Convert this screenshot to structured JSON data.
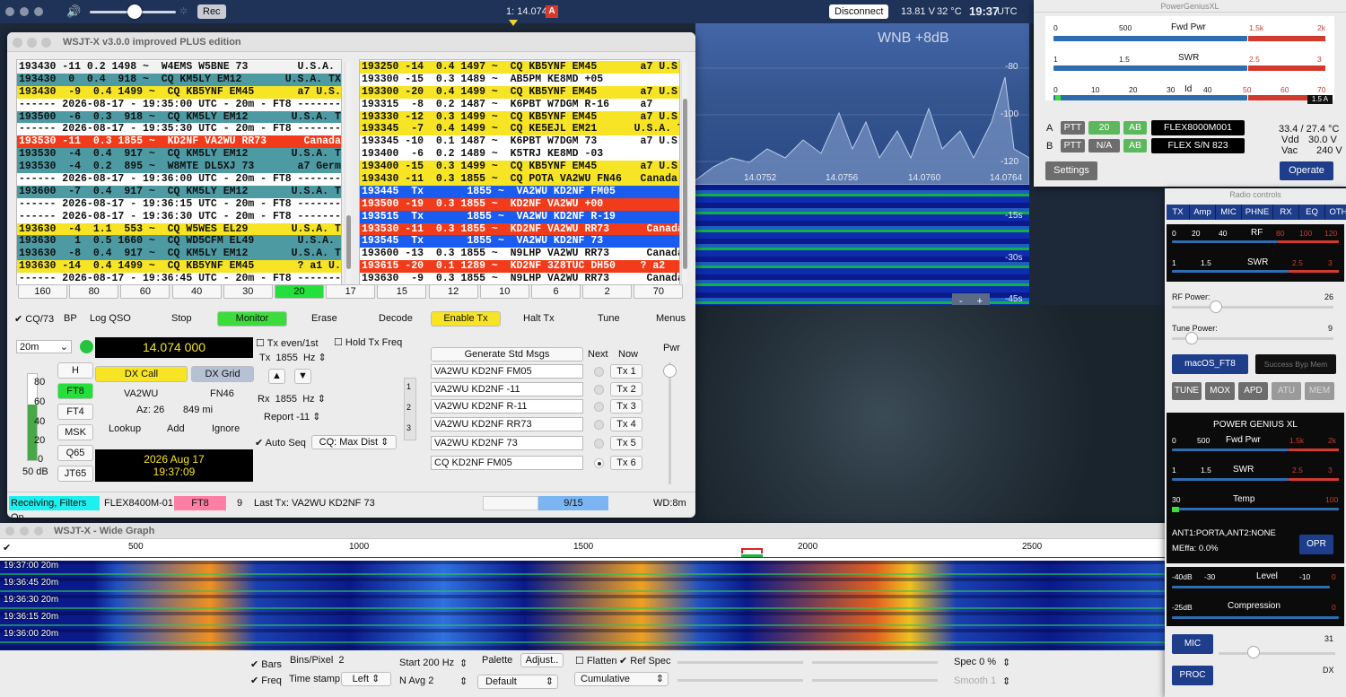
{
  "topbar": {
    "freq": "1: 14.074",
    "freq_flag": "A",
    "disconnect": "Disconnect",
    "volts": "13.81 V",
    "temp": "32 °C",
    "time": "19:37",
    "tz": "UTC",
    "rec": "Rec"
  },
  "pan": {
    "wnb": "WNB +8dB",
    "db": [
      "-80",
      "-100",
      "-120"
    ],
    "freqs": [
      "14.0752",
      "14.0756",
      "14.0760",
      "14.0764"
    ],
    "wf_times": [
      "-15s",
      "-30s",
      "-45s"
    ],
    "zoom_minus": "-",
    "zoom_plus": "+"
  },
  "wsjt": {
    "title": "WSJT-X   v3.0.0  improved PLUS edition",
    "left_rows": [
      {
        "t": "193430 -11 0.2 1498 ~  W4EMS W5BNE 73        U.S.A. TX",
        "c": "#f2f2f2"
      },
      {
        "t": "193430  0  0.4  918 ~  CQ KM5LY EM12       U.S.A. TX",
        "c": "#4d9aa3"
      },
      {
        "t": "193430  -9  0.4 1499 ~  CQ KB5YNF EM45       a7 U.S.A. AR-TN",
        "c": "#f6e425"
      },
      {
        "t": "------ 2026-08-17 - 19:35:00 UTC - 20m - FT8 ---------",
        "c": "#fff"
      },
      {
        "t": "193500  -6  0.3  918 ~  CQ KM5LY EM12       U.S.A. TX",
        "c": "#4d9aa3"
      },
      {
        "t": "------ 2026-08-17 - 19:35:30 UTC - 20m - FT8 ---------",
        "c": "#fff"
      },
      {
        "t": "193530 -11  0.3 1855 ~  KD2NF VA2WU RR73      Canada",
        "c": "#f23b1a"
      },
      {
        "t": "193530  -4  0.4  917 ~  CQ KM5LY EM12       U.S.A. TX",
        "c": "#4d9aa3"
      },
      {
        "t": "193530  -4  0.2  895 ~  W8MTE DL5XJ 73       a7 Germany",
        "c": "#4d9aa3"
      },
      {
        "t": "------ 2026-08-17 - 19:36:00 UTC - 20m - FT8 ---------",
        "c": "#fff"
      },
      {
        "t": "193600  -7  0.4  917 ~  CQ KM5LY EM12       U.S.A. TX",
        "c": "#4d9aa3"
      },
      {
        "t": "------ 2026-08-17 - 19:36:15 UTC - 20m - FT8 ---------",
        "c": "#fff"
      },
      {
        "t": "------ 2026-08-17 - 19:36:30 UTC - 20m - FT8 ---------",
        "c": "#fff"
      },
      {
        "t": "193630  -4  1.1  553 ~  CQ W5WES EL29       U.S.A. TX",
        "c": "#f6e425"
      },
      {
        "t": "193630   1  0.5 1660 ~  CQ WD5CFM EL49       U.S.A. LA",
        "c": "#4d9aa3"
      },
      {
        "t": "193630  -8  0.4  917 ~  CQ KM5LY EM12       U.S.A. TX",
        "c": "#4d9aa3"
      },
      {
        "t": "193630 -14  0.4 1499 ~  CQ KB5YNF EM45       ? a1 U.S.A. AR-TN",
        "c": "#f6e425"
      },
      {
        "t": "------ 2026-08-17 - 19:36:45 UTC - 20m - FT8 ---------",
        "c": "#fff"
      }
    ],
    "right_rows": [
      {
        "t": "193250 -14  0.4 1497 ~  CQ KB5YNF EM45       a7 U.S.A. AR-TN",
        "c": "#f6e425"
      },
      {
        "t": "193300 -15  0.3 1489 ~  AB5PM KE8MD +05",
        "c": "#fff"
      },
      {
        "t": "193300 -20  0.4 1499 ~  CQ KB5YNF EM45       a7 U.S.A. AR-TN",
        "c": "#f6e425"
      },
      {
        "t": "193315  -8  0.2 1487 ~  K6PBT W7DGM R-16     a7",
        "c": "#fff"
      },
      {
        "t": "193330 -12  0.3 1499 ~  CQ KB5YNF EM45       a7 U.S.A. AR-TN",
        "c": "#f6e425"
      },
      {
        "t": "193345  -7  0.4 1499 ~  CQ KE5EJL EM21      U.S.A. TX-LA",
        "c": "#f6e425"
      },
      {
        "t": "193345 -10  0.1 1487 ~  K6PBT W7DGM 73       a7 U.S.A.",
        "c": "#fff"
      },
      {
        "t": "193400  -6  0.2 1489 ~  K5TRJ KE8MD -03",
        "c": "#fff"
      },
      {
        "t": "193400 -15  0.3 1499 ~  CQ KB5YNF EM45       a7 U.S.A. AR-TN",
        "c": "#f6e425"
      },
      {
        "t": "193430 -11  0.3 1855 ~  CQ POTA VA2WU FN46   Canada",
        "c": "#f6e425"
      },
      {
        "t": "193445  Tx       1855 ~  VA2WU KD2NF FM05",
        "c": "#1a5cf0"
      },
      {
        "t": "193500 -19  0.3 1855 ~  KD2NF VA2WU +00",
        "c": "#f23b1a"
      },
      {
        "t": "193515  Tx       1855 ~  VA2WU KD2NF R-19",
        "c": "#1a5cf0"
      },
      {
        "t": "193530 -11  0.3 1855 ~  KD2NF VA2WU RR73      Canada",
        "c": "#f23b1a"
      },
      {
        "t": "193545  Tx       1855 ~  VA2WU KD2NF 73",
        "c": "#1a5cf0"
      },
      {
        "t": "193600 -13  0.3 1855 ~  N9LHP VA2WU RR73      Canada",
        "c": "#fff"
      },
      {
        "t": "193615 -20  0.1 1289 ~  KD2NF 3Z8TUC DH50    ? a2",
        "c": "#f23b1a"
      },
      {
        "t": "193630  -9  0.3 1855 ~  N9LHP VA2WU RR73      Canada",
        "c": "#fff"
      }
    ],
    "bands": [
      "160",
      "80",
      "60",
      "40",
      "30",
      "20",
      "17",
      "15",
      "12",
      "10",
      "6",
      "2",
      "70"
    ],
    "controls": {
      "cq73": "CQ/73",
      "bp": "BP",
      "logqso": "Log QSO",
      "stop": "Stop",
      "monitor": "Monitor",
      "erase": "Erase",
      "decode": "Decode",
      "enabletx": "Enable Tx",
      "halttx": "Halt Tx",
      "tune": "Tune",
      "menus": "Menus"
    },
    "band": "20m",
    "dialfreq": "14.074 000",
    "modes": [
      "H",
      "FT8",
      "FT4",
      "MSK",
      "Q65",
      "JT65"
    ],
    "meter": {
      "scale": [
        "80",
        "60",
        "40",
        "20",
        "0"
      ],
      "db": "50 dB"
    },
    "dxcall_btn": "DX Call",
    "dxgrid_btn": "DX Grid",
    "dxcall": "VA2WU",
    "dxgrid": "FN46",
    "az": "Az: 26",
    "dist": "849 mi",
    "lookup": "Lookup",
    "add": "Add",
    "ignore": "Ignore",
    "date": "2026 Aug 17",
    "utc": "19:37:09",
    "txeven": "Tx even/1st",
    "holdtx": "Hold Tx Freq",
    "tx_lbl": "Tx",
    "tx_hz": "1855",
    "hz": "Hz",
    "rx_lbl": "Rx",
    "rx_hz": "1855",
    "report": "Report -11",
    "autoseq": "Auto Seq",
    "cqmax": "CQ: Max Dist",
    "gen": "Generate Std Msgs",
    "next": "Next",
    "now": "Now",
    "msgs": [
      "VA2WU KD2NF FM05",
      "VA2WU KD2NF -11",
      "VA2WU KD2NF R-11",
      "VA2WU KD2NF RR73",
      "VA2WU KD2NF 73",
      "CQ KD2NF FM05"
    ],
    "txbtns": [
      "Tx 1",
      "Tx 2",
      "Tx 3",
      "Tx 4",
      "Tx 5",
      "Tx 6"
    ],
    "tabs": [
      "1",
      "2",
      "3"
    ],
    "pwr": "Pwr",
    "status": {
      "recv": "Receiving, Filters On",
      "rig": "FLEX8400M-01",
      "mode": "FT8",
      "num": "9",
      "lasttx": "Last Tx: VA2WU KD2NF 73",
      "prog": "9/15",
      "wd": "WD:8m"
    }
  },
  "wide": {
    "title": "WSJT-X - Wide Graph",
    "scale": [
      "500",
      "1000",
      "1500",
      "2000",
      "2500"
    ],
    "times": [
      "19:37:00   20m",
      "19:36:45   20m",
      "19:36:30   20m",
      "19:36:15   20m",
      "19:36:00   20m"
    ],
    "bars": "Bars",
    "freq": "Freq",
    "bins": "Bins/Pixel",
    "bins_val": "2",
    "timestamp": "Time stamp",
    "ts_val": "Left",
    "start": "Start 200 Hz",
    "navg": "N Avg 2",
    "palette": "Palette",
    "adjust": "Adjust..",
    "default": "Default",
    "flatten": "Flatten",
    "refspec": "Ref Spec",
    "cumulative": "Cumulative",
    "spec": "Spec 0 %",
    "smooth": "Smooth 1"
  },
  "pg": {
    "title": "PowerGeniusXL",
    "fwd": {
      "label": "Fwd Pwr",
      "scale": [
        "0",
        "500",
        "1.5k",
        "2k"
      ]
    },
    "swr": {
      "label": "SWR",
      "scale": [
        "1",
        "1.5",
        "2.5",
        "3"
      ]
    },
    "id": {
      "label": "Id",
      "scale": [
        "0",
        "10",
        "20",
        "30",
        "40",
        "50",
        "60",
        "70"
      ],
      "val": "1.5 A"
    },
    "rowA": {
      "k": "A",
      "ptt": "PTT",
      "band": "20",
      "ab": "AB",
      "name": "FLEX8000M001"
    },
    "rowB": {
      "k": "B",
      "ptt": "PTT",
      "band": "N/A",
      "ab": "AB",
      "name": "FLEX S/N 823"
    },
    "temp": "33.4 / 27.4 °C",
    "vdd_l": "Vdd",
    "vdd": "30.0 V",
    "vac_l": "Vac",
    "vac": "240 V",
    "settings": "Settings",
    "operate": "Operate"
  },
  "rc": {
    "title": "Radio controls",
    "tabs": [
      "TX",
      "Amp",
      "MIC",
      "PHNE",
      "RX",
      "EQ",
      "OTH"
    ],
    "rf": {
      "label": "RF",
      "scale": [
        "0",
        "20",
        "40",
        "80",
        "100",
        "120"
      ]
    },
    "swr": {
      "label": "SWR",
      "scale": [
        "1",
        "1.5",
        "2.5",
        "3"
      ]
    },
    "rfpower": "RF Power:",
    "rfpower_val": "26",
    "tunepower": "Tune Power:",
    "tunepower_val": "9",
    "profile": "macOS_FT8",
    "success": "Success Byp Mem",
    "btns": [
      "TUNE",
      "MOX",
      "APD",
      "ATU",
      "MEM"
    ],
    "pgxl": "POWER GENIUS XL",
    "fwd": {
      "label": "Fwd Pwr",
      "scale": [
        "0",
        "500",
        "1.5k",
        "2k"
      ]
    },
    "swr2": {
      "label": "SWR",
      "scale": [
        "1",
        "1.5",
        "2.5",
        "3"
      ]
    },
    "temp": {
      "label": "Temp",
      "scale": [
        "30",
        "100"
      ]
    },
    "ant": "ANT1:PORTA,ANT2:NONE",
    "meffa": "MEffa: 0.0%",
    "opr": "OPR",
    "level": {
      "label": "Level",
      "scale": [
        "-40dB",
        "-30",
        "-10",
        "0"
      ]
    },
    "comp": {
      "label": "Compression",
      "scale": [
        "-25dB",
        "0"
      ]
    },
    "mic": "MIC",
    "mic_val": "31",
    "proc": "PROC",
    "dx": "DX"
  },
  "colors": {
    "accent": "#1e3e8c",
    "green": "#3cdc3c",
    "yellow": "#f6e425",
    "red": "#f23b1a",
    "blue": "#1a5cf0",
    "teal": "#4d9aa3"
  }
}
